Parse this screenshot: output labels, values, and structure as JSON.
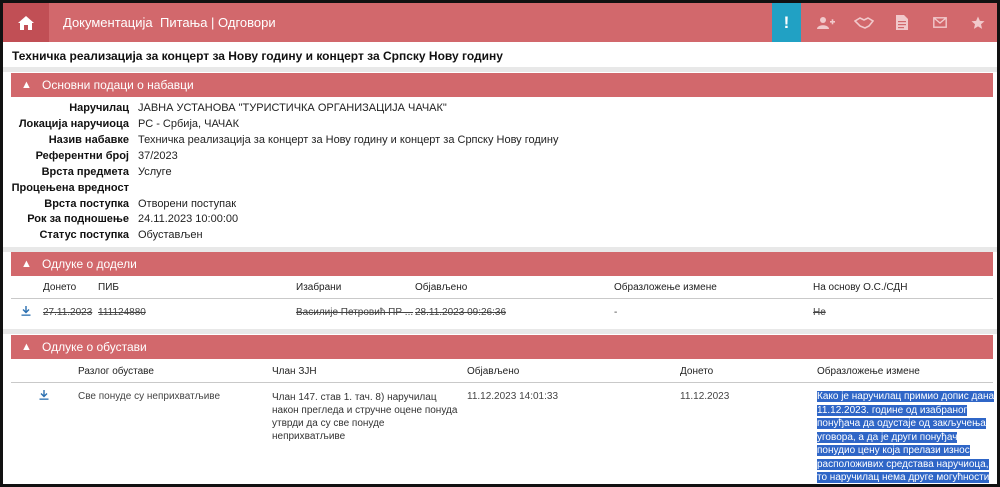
{
  "nav": {
    "links": [
      "Документација",
      "Питања | Одговори"
    ],
    "icons": [
      "home-icon",
      "alert-icon",
      "add-user-icon",
      "handshake-icon",
      "document-icon",
      "mail-icon",
      "star-icon"
    ],
    "alert_label": "!"
  },
  "page": {
    "title": "Техничка реализација за концерт за Нову годину и концерт за Српску Нову годину"
  },
  "basic": {
    "heading": "Основни подаци о набавци",
    "fields": [
      {
        "label": "Наручилац",
        "value": "ЈАВНА УСТАНОВА \"ТУРИСТИЧКА ОРГАНИЗАЦИЈА ЧАЧАК\""
      },
      {
        "label": "Локација наручиоца",
        "value": "РС - Србија, ЧАЧАК"
      },
      {
        "label": "Назив набавке",
        "value": "Техничка реализација за концерт за Нову годину и концерт за Српску Нову годину"
      },
      {
        "label": "Референтни број",
        "value": "37/2023"
      },
      {
        "label": "Врста предмета",
        "value": "Услуге"
      },
      {
        "label": "Процењена вредност",
        "value": ""
      },
      {
        "label": "Врста поступка",
        "value": "Отворени поступак"
      },
      {
        "label": "Рок за подношење",
        "value": "24.11.2023 10:00:00"
      },
      {
        "label": "Статус поступка",
        "value": "Обустављен"
      }
    ]
  },
  "award": {
    "heading": "Одлуке о додели",
    "columns": [
      "Донето",
      "ПИБ",
      "Изабрани",
      "Објављено",
      "Образложење измене",
      "На основу О.С./СДН"
    ],
    "row": [
      "27.11.2023",
      "111124880",
      "Василије Петровић ПР ...",
      "28.11.2023 09:26:36",
      "-",
      "Не"
    ]
  },
  "suspension": {
    "heading": "Одлуке о обустави",
    "columns": [
      "Разлог обуставе",
      "Члан ЗЈН",
      "Објављено",
      "Донето",
      "Образложење измене"
    ],
    "row": {
      "reason": "Све понуде су неприхватљиве",
      "article": "Члан 147. став 1. тач. 8) наручилац након прегледа и стручне оцене понуда утврди да су све понуде неприхватљиве",
      "published": "11.12.2023 14:01:33",
      "decided": "11.12.2023",
      "explanation": "Како је наручилац примио допис дана 11.12.2023. године од изабраног понуђача да одустаје од закључења уговора, а да је други понуђач понудио цену која прелази износ расположивих средстава наручиоца, то наручилац нема друге могућности осим да обустави поступак."
    }
  },
  "colors": {
    "brand": "#d2686c",
    "brand_dark": "#c14f55",
    "alert": "#21a1c4",
    "selection": "#2f66c7"
  }
}
